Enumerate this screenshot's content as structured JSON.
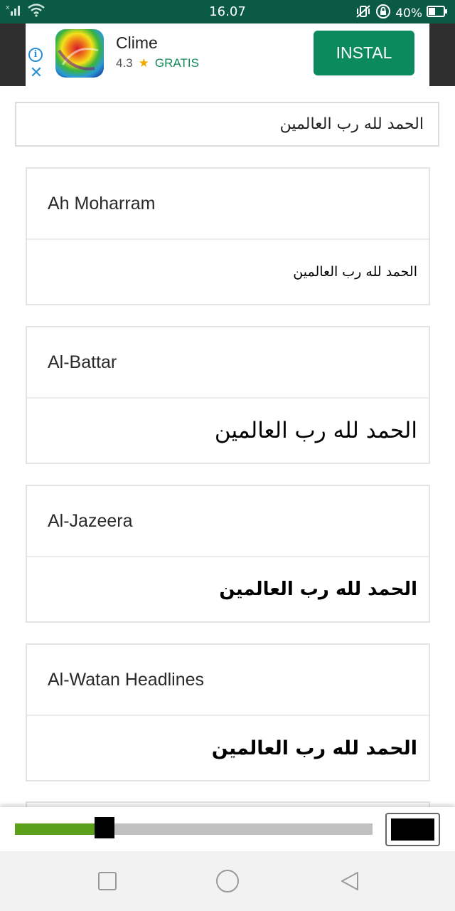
{
  "status_bar": {
    "time": "16.07",
    "battery": "40%",
    "icons": [
      "sim-signal-icon",
      "wifi-icon",
      "vibrate-icon",
      "rotation-lock-icon",
      "battery-icon"
    ]
  },
  "ad": {
    "app_name": "Clime",
    "rating": "4.3",
    "price": "GRATIS",
    "install_label": "INSTAL",
    "colors": {
      "install_button": "#0b8a5d",
      "price": "#0f8a56",
      "star": "#f2a900"
    }
  },
  "input": {
    "value": "الحمد لله رب العالمين"
  },
  "fonts": [
    {
      "name": "Ah Moharram",
      "sample": "الحمد لله رب العالمين"
    },
    {
      "name": "Al-Battar",
      "sample": "الحمد لله رب العالمين"
    },
    {
      "name": "Al-Jazeera",
      "sample": "الحمد لله رب العالمين"
    },
    {
      "name": "Al-Watan Headlines",
      "sample": "الحمد لله رب العالمين"
    }
  ],
  "size_slider": {
    "value_fraction": 0.25,
    "fill_color": "#5aa018",
    "track_color": "#c0c0c0"
  },
  "color_picker": {
    "selected_color": "#000000"
  },
  "nav_bar": {
    "buttons": [
      "recent-apps-icon",
      "home-icon",
      "back-icon"
    ]
  }
}
